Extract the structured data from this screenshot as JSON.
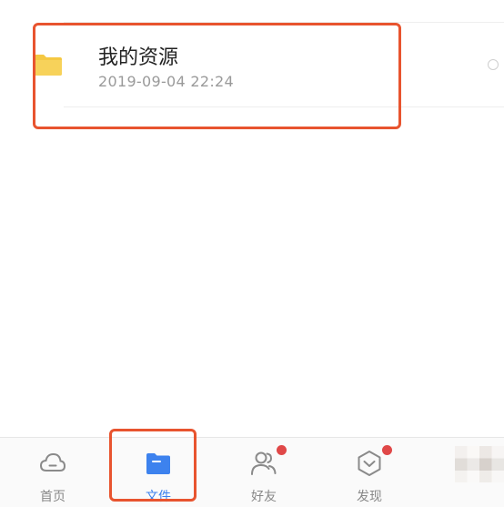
{
  "file_list": {
    "items": [
      {
        "name": "我的资源",
        "date": "2019-09-04 22:24",
        "icon": "folder-icon",
        "icon_color": "#f5c842"
      }
    ]
  },
  "tabbar": {
    "tabs": [
      {
        "label": "首页",
        "icon": "cloud-icon",
        "active": false,
        "badge": false
      },
      {
        "label": "文件",
        "icon": "folder-icon",
        "active": true,
        "badge": false
      },
      {
        "label": "好友",
        "icon": "friends-icon",
        "active": false,
        "badge": true
      },
      {
        "label": "发现",
        "icon": "discover-icon",
        "active": false,
        "badge": true
      }
    ]
  },
  "colors": {
    "highlight": "#e8542f",
    "active_tab": "#3d82ee",
    "badge": "#e04848",
    "folder": "#f5c842"
  }
}
